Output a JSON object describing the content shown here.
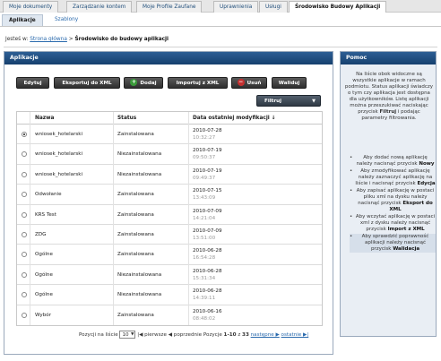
{
  "top_tabs": [
    {
      "label": "Moje dokumenty"
    },
    {
      "label": "Zarządzanie kontem"
    },
    {
      "label": "Moje Profile Zaufane"
    },
    {
      "label": "Uprawnienia"
    },
    {
      "label": "Usługi"
    },
    {
      "label": "Środowisko Budowy Aplikacji"
    }
  ],
  "sub_tabs": [
    {
      "label": "Aplikacje"
    },
    {
      "label": "Szablony"
    }
  ],
  "breadcrumb": {
    "prefix": "Jesteś w:",
    "home": "Strona główna",
    "separator": ">",
    "current": "Środowisko do budowy aplikacji"
  },
  "main": {
    "title": "Aplikacje",
    "buttons": {
      "edit": "Edytuj",
      "export": "Eksportuj do XML",
      "add": "Dodaj",
      "import": "Importuj z XML",
      "delete": "Usuń",
      "validate": "Waliduj",
      "filter": "Filtruj"
    },
    "table": {
      "columns": {
        "name": "Nazwa",
        "status": "Status",
        "date": "Data ostatniej modyfikacji ↓"
      },
      "rows": [
        {
          "name": "wniosek_hotelarski",
          "status": "Zainstalowana",
          "date": "2010-07-28",
          "time": "10:32:27",
          "selected": true
        },
        {
          "name": "wniosek_hotelarski",
          "status": "Niezainstalowana",
          "date": "2010-07-19",
          "time": "09:50:37",
          "selected": false
        },
        {
          "name": "wniosek_hotelarski",
          "status": "Niezainstalowana",
          "date": "2010-07-19",
          "time": "09:49:37",
          "selected": false
        },
        {
          "name": "Odwołanie",
          "status": "Zainstalowana",
          "date": "2010-07-15",
          "time": "13:43:09",
          "selected": false
        },
        {
          "name": "KRS Test",
          "status": "Zainstalowana",
          "date": "2010-07-09",
          "time": "14:21:04",
          "selected": false
        },
        {
          "name": "ZDG",
          "status": "Zainstalowana",
          "date": "2010-07-09",
          "time": "13:51:00",
          "selected": false
        },
        {
          "name": "Ogólne",
          "status": "Zainstalowana",
          "date": "2010-06-28",
          "time": "16:54:28",
          "selected": false
        },
        {
          "name": "Ogólne",
          "status": "Niezainstalowana",
          "date": "2010-06-28",
          "time": "15:31:34",
          "selected": false
        },
        {
          "name": "Ogólne",
          "status": "Niezainstalowana",
          "date": "2010-06-28",
          "time": "14:39:11",
          "selected": false
        },
        {
          "name": "Wybór",
          "status": "Zainstalowana",
          "date": "2010-06-16",
          "time": "08:48:02",
          "selected": false
        }
      ]
    },
    "pager": {
      "per_page_label": "Pozycji na liście",
      "per_page_value": "10",
      "first": "|◀ pierwsze",
      "prev": "◀ poprzednie",
      "positions": "Pozycje",
      "range": "1-10",
      "of": "z",
      "total": "33",
      "next": "następne ▶",
      "last": "ostatnie ▶|"
    }
  },
  "help": {
    "title": "Pomoc",
    "intro": "Na liście obok widoczne są wszystkie aplikacje w ramach podmiotu. Status aplikacji świadczy o tym czy aplikacja jest dostępna dla użytkowników. Listę aplikacji można przeszukiwać naciskając przycisk",
    "intro_bold": "Filtruj",
    "intro_end": "i podając parametry filtrowania.",
    "items": [
      {
        "text": "Aby dodać nową aplikację należy nacisnąć przycisk",
        "bold": "Nowy"
      },
      {
        "text": "Aby zmodyfikować aplikację należy zaznaczyć aplikację na liście i nacisnąć przycisk",
        "bold": "Edycja"
      },
      {
        "text": "Aby zapisać aplikację w postaci pliku xml na dysku należy nacisnąć przycisk",
        "bold": "Eksport do XML"
      },
      {
        "text": "Aby wczytać aplikację w postaci xml z dysku należy nacisnąć przycisk",
        "bold": "Import z XML"
      },
      {
        "text": "Aby sprawdzić poprawność aplikacji należy nacisnąć przycisk",
        "bold": "Walidacja"
      }
    ]
  }
}
